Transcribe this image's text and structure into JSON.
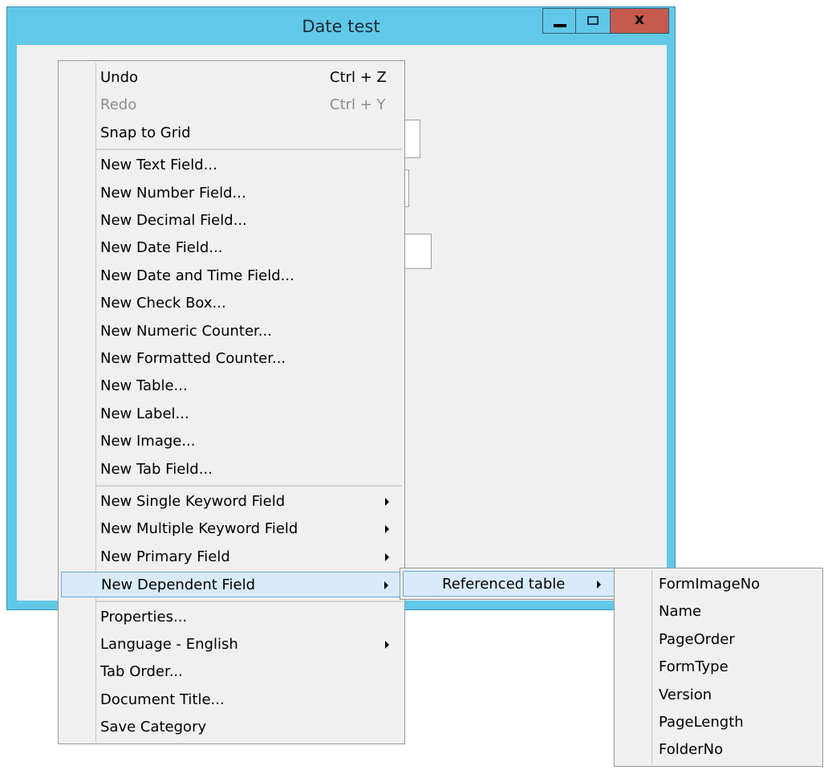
{
  "window": {
    "title": "Date test",
    "minimize_glyph": "",
    "maximize_glyph": "",
    "close_glyph": "x"
  },
  "context_menu": {
    "items": [
      {
        "label": "Undo",
        "shortcut": "Ctrl + Z",
        "enabled": true
      },
      {
        "label": "Redo",
        "shortcut": "Ctrl + Y",
        "enabled": false
      },
      {
        "label": "Snap to Grid"
      },
      {
        "label": "New Text Field..."
      },
      {
        "label": "New Number Field..."
      },
      {
        "label": "New Decimal Field..."
      },
      {
        "label": "New Date Field..."
      },
      {
        "label": "New Date and Time Field..."
      },
      {
        "label": "New Check Box..."
      },
      {
        "label": "New Numeric Counter..."
      },
      {
        "label": "New Formatted Counter..."
      },
      {
        "label": "New Table..."
      },
      {
        "label": "New Label..."
      },
      {
        "label": "New Image..."
      },
      {
        "label": "New Tab Field..."
      },
      {
        "label": "New Single Keyword Field",
        "submenu": true
      },
      {
        "label": "New Multiple Keyword Field",
        "submenu": true
      },
      {
        "label": "New Primary Field",
        "submenu": true
      },
      {
        "label": "New Dependent Field",
        "submenu": true,
        "highlighted": true
      },
      {
        "label": "Properties..."
      },
      {
        "label": "Language - English",
        "submenu": true
      },
      {
        "label": "Tab Order..."
      },
      {
        "label": "Document Title..."
      },
      {
        "label": "Save Category"
      }
    ]
  },
  "submenu_dependent": {
    "items": [
      {
        "label": "Referenced table",
        "submenu": true,
        "highlighted": true
      }
    ]
  },
  "submenu_referenced_table": {
    "items": [
      {
        "label": "FormImageNo"
      },
      {
        "label": "Name"
      },
      {
        "label": "PageOrder"
      },
      {
        "label": "FormType"
      },
      {
        "label": "Version"
      },
      {
        "label": "PageLength"
      },
      {
        "label": "FolderNo"
      }
    ]
  },
  "colors": {
    "title_bar": "#62c8e8",
    "close_button": "#c65a4c",
    "menu_background": "#f0f0f0",
    "highlight_background": "#d9ebfa",
    "highlight_border": "#6aa8df",
    "disabled_text": "#8d8d8d"
  }
}
